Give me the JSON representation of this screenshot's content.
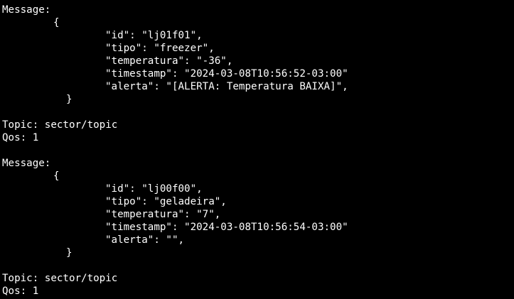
{
  "terminal": {
    "blocks": [
      {
        "message_label": "Message:",
        "open_brace": "{",
        "fields": [
          "\"id\": \"lj01f01\",",
          "\"tipo\": \"freezer\",",
          "\"temperatura\": \"-36\",",
          "\"timestamp\": \"2024-03-08T10:56:52-03:00\"",
          "\"alerta\": \"[ALERTA: Temperatura BAIXA]\","
        ],
        "close_brace": "}",
        "topic": "Topic: sector/topic",
        "qos": "Qos: 1"
      },
      {
        "message_label": "Message:",
        "open_brace": "{",
        "fields": [
          "\"id\": \"lj00f00\",",
          "\"tipo\": \"geladeira\",",
          "\"temperatura\": \"7\",",
          "\"timestamp\": \"2024-03-08T10:56:54-03:00\"",
          "\"alerta\": \"\","
        ],
        "close_brace": "}",
        "topic": "Topic: sector/topic",
        "qos": "Qos: 1"
      }
    ]
  }
}
